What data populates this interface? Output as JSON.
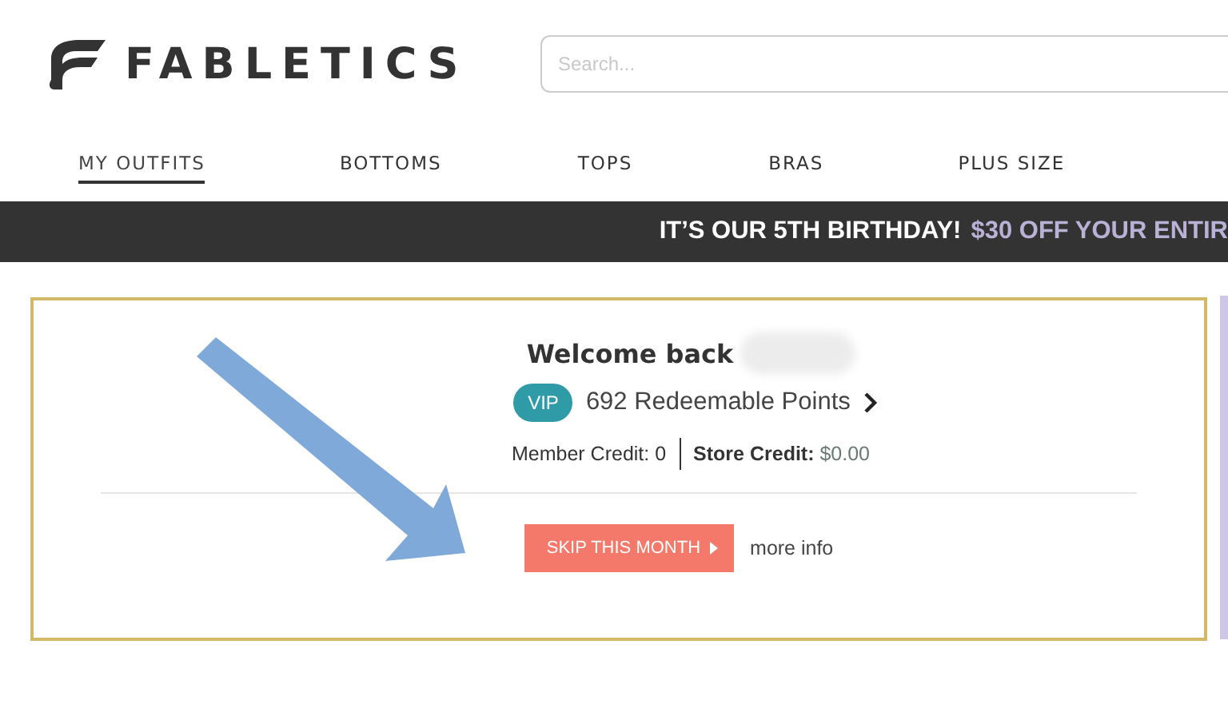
{
  "header": {
    "brand": "FABLETICS",
    "search": {
      "placeholder": "Search..."
    }
  },
  "nav": [
    {
      "label": "MY OUTFITS",
      "selected": true
    },
    {
      "label": "BOTTOMS",
      "selected": false
    },
    {
      "label": "TOPS",
      "selected": false
    },
    {
      "label": "BRAS",
      "selected": false
    },
    {
      "label": "PLUS SIZE",
      "selected": false
    }
  ],
  "banner": {
    "headline": "IT’S OUR 5TH BIRTHDAY!",
    "offer": "$30 OFF YOUR ENTIR"
  },
  "account": {
    "greeting": "Welcome back",
    "badge": "VIP",
    "points": "692 Redeemable Points",
    "member_credit": "Member Credit: 0",
    "store_credit": "**Store Credit:** $0.00",
    "skip_button": "SKIP THIS MONTH",
    "more_info": "more info"
  }
}
